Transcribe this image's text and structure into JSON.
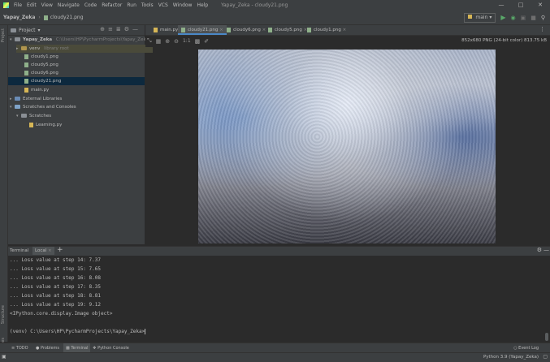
{
  "menu": [
    "File",
    "Edit",
    "View",
    "Navigate",
    "Code",
    "Refactor",
    "Run",
    "Tools",
    "VCS",
    "Window",
    "Help"
  ],
  "window_title": "Yapay_Zeka - cloudy21.png",
  "breadcrumb": {
    "project": "Yapay_Zeka",
    "file": "cloudy21.png"
  },
  "run_config": "main",
  "project_panel": {
    "title": "Project",
    "items": [
      {
        "label": "Yapay_Zeka",
        "extra": "C:\\Users\\HP\\PycharmProjects\\Yapay_Zeka"
      },
      {
        "label": "venv",
        "extra": "library root"
      },
      {
        "label": "cloudy1.png"
      },
      {
        "label": "cloudy5.png"
      },
      {
        "label": "cloudy6.png"
      },
      {
        "label": "cloudy21.png"
      },
      {
        "label": "main.py"
      },
      {
        "label": "External Libraries"
      },
      {
        "label": "Scratches and Consoles"
      },
      {
        "label": "Scratches"
      },
      {
        "label": "Learning.py"
      }
    ]
  },
  "editor_tabs": [
    "main.py",
    "cloudy21.png",
    "cloudy6.png",
    "cloudy5.png",
    "cloudy1.png"
  ],
  "image_info": "852x680 PNG (24-bit color) 813.75 kB",
  "image_zoom_label": "1:1",
  "terminal_tabs": {
    "terminal": "Terminal",
    "local": "Local"
  },
  "terminal_lines": [
    "... Loss value at step 14: 7.37",
    "... Loss value at step 15: 7.65",
    "... Loss value at step 16: 8.08",
    "... Loss value at step 17: 8.35",
    "... Loss value at step 18: 8.81",
    "... Loss value at step 19: 9.12",
    "<IPython.core.display.Image object>",
    "",
    "(venv) C:\\Users\\HP\\PycharmProjects\\Yapay_Zeka>"
  ],
  "bottom_tabs": [
    "TODO",
    "Problems",
    "Terminal",
    "Python Console"
  ],
  "event_log": "Event Log",
  "left_stripe": {
    "project": "Project",
    "structure": "Structure",
    "favorites": "Favorites"
  },
  "status_interpreter": "Python 3.9 (Yapay_Zeka)"
}
